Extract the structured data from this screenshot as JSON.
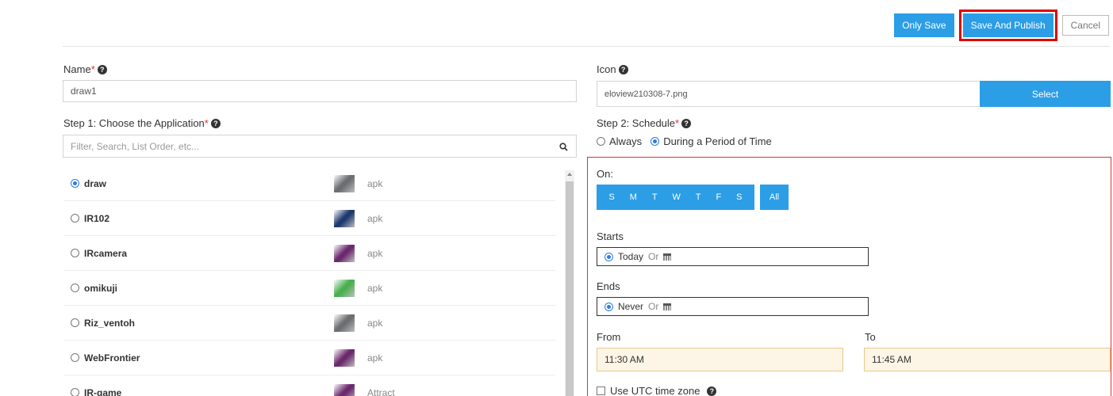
{
  "toolbar": {
    "only_save_label": "Only Save",
    "save_publish_label": "Save And Publish",
    "cancel_label": "Cancel"
  },
  "form": {
    "name_label": "Name",
    "required_mark": "*",
    "help_glyph": "?",
    "name_value": "draw1",
    "icon_label": "Icon",
    "icon_value": "eloview210308-7.png",
    "select_label": "Select"
  },
  "step1": {
    "label": "Step 1: Choose the Application",
    "filter_placeholder": "Filter, Search, List Order, etc...",
    "apps": [
      {
        "name": "draw",
        "type": "apk",
        "selected": true,
        "icon_color": "#6d6e71"
      },
      {
        "name": "IR102",
        "type": "apk",
        "selected": false,
        "icon_color": "#1f3a6e"
      },
      {
        "name": "IRcamera",
        "type": "apk",
        "selected": false,
        "icon_color": "#6b2a6e"
      },
      {
        "name": "omikuji",
        "type": "apk",
        "selected": false,
        "icon_color": "#4caf50"
      },
      {
        "name": "Riz_ventoh",
        "type": "apk",
        "selected": false,
        "icon_color": "#6d6e71"
      },
      {
        "name": "WebFrontier",
        "type": "apk",
        "selected": false,
        "icon_color": "#6b2a6e"
      },
      {
        "name": "IR-game",
        "type": "Attract",
        "selected": false,
        "icon_color": "#6b2a6e"
      }
    ]
  },
  "step2": {
    "label": "Step 2: Schedule",
    "always_label": "Always",
    "period_label": "During a Period of Time",
    "mode": "During a Period of Time",
    "on_label": "On:",
    "days": [
      "S",
      "M",
      "T",
      "W",
      "T",
      "F",
      "S"
    ],
    "all_label": "All",
    "starts_label": "Starts",
    "starts_value": "Today",
    "ends_label": "Ends",
    "ends_value": "Never",
    "or_label": "Or",
    "from_label": "From",
    "from_value": "11:30 AM",
    "to_label": "To",
    "to_value": "11:45 AM",
    "utc_label": "Use UTC time zone"
  },
  "colors": {
    "accent": "#2c9ee6",
    "highlight": "#e00000",
    "required": "#e03030",
    "time_bg": "#fdf5e6"
  }
}
